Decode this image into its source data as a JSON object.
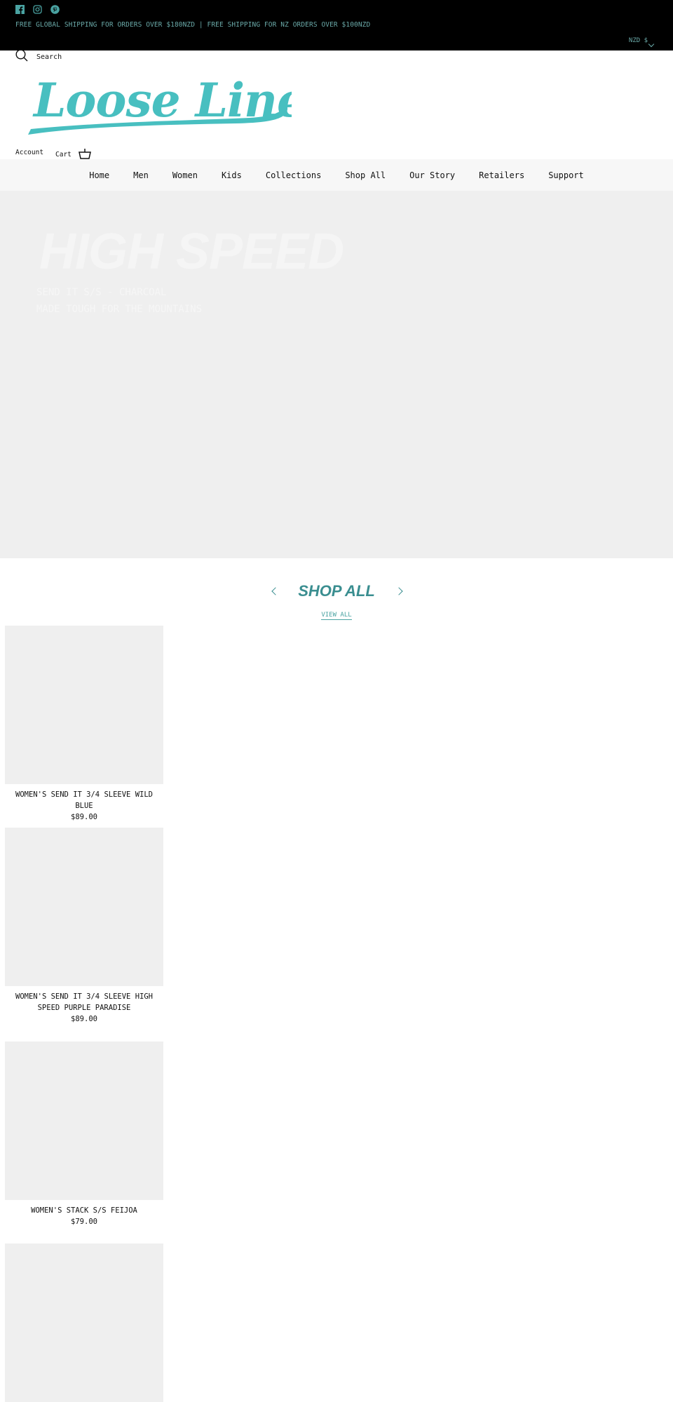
{
  "announcement": {
    "social": [
      "facebook-icon",
      "instagram-icon",
      "pinterest-icon"
    ],
    "shipping_text": "FREE GLOBAL SHIPPING FOR ORDERS OVER $180NZD | FREE SHIPPING FOR NZ ORDERS OVER $100NZD",
    "currency": "NZD $"
  },
  "header": {
    "search_label": "Search",
    "logo_text": "Loose Line",
    "account_label": "Account",
    "cart_label": "Cart"
  },
  "nav": {
    "items": [
      "Home",
      "Men",
      "Women",
      "Kids",
      "Collections",
      "Shop All",
      "Our Story",
      "Retailers",
      "Support"
    ]
  },
  "hero": {
    "title": "HIGH SPEED",
    "subtitle_1": "SEND IT S/S - CHARCOAL",
    "subtitle_2": "MADE TOUGH FOR THE MOUNTAINS"
  },
  "shop_all": {
    "title": "SHOP ALL",
    "view_all": "VIEW ALL",
    "products": [
      {
        "name": "WOMEN'S SEND IT 3/4 SLEEVE WILD BLUE",
        "price": "$89.00"
      },
      {
        "name": "WOMEN'S SEND IT 3/4 SLEEVE HIGH SPEED PURPLE PARADISE",
        "price": "$89.00"
      },
      {
        "name": "WOMEN'S STACK S/S FEIJOA",
        "price": "$79.00"
      }
    ]
  },
  "colors": {
    "accent": "#4ABFBF",
    "accent_dark": "#3A8E90",
    "topbar": "#000000"
  }
}
